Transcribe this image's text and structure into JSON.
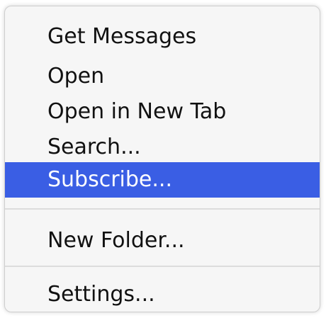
{
  "menu": {
    "items": [
      {
        "label": "Get Messages",
        "selected": false
      },
      {
        "label": "Open",
        "selected": false
      },
      {
        "label": "Open in New Tab",
        "selected": false
      },
      {
        "label": "Search...",
        "selected": false
      },
      {
        "label": "Subscribe...",
        "selected": true
      },
      {
        "label": "New Folder...",
        "selected": false
      },
      {
        "label": "Settings...",
        "selected": false
      }
    ]
  },
  "colors": {
    "selection": "#3a5ee4",
    "menu_background": "#f6f6f6",
    "text": "#111111",
    "selected_text": "#ffffff",
    "separator": "#dcdcdc"
  }
}
